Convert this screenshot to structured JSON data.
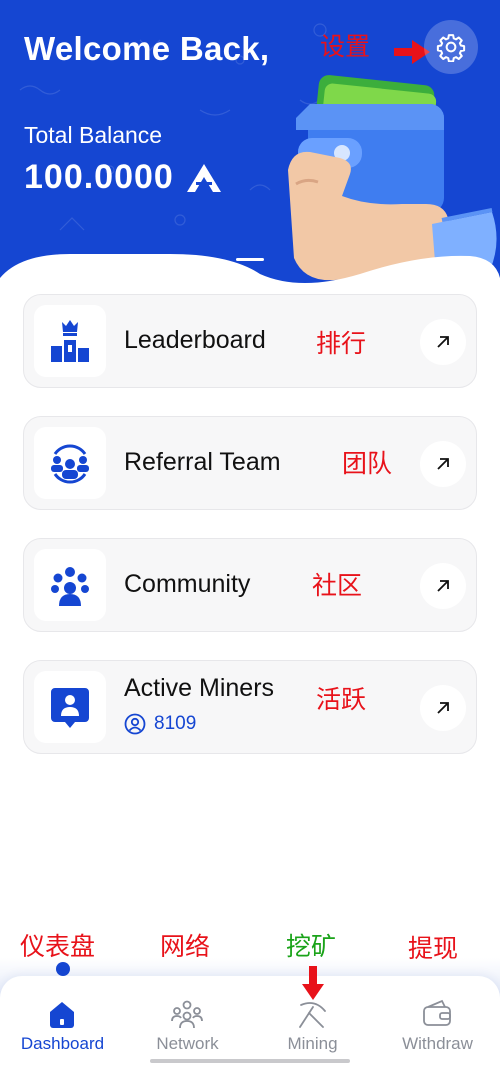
{
  "header": {
    "greeting": "Welcome Back,",
    "balance_label": "Total Balance",
    "balance_value": "100.0000",
    "coin_icon": "coin-logo-icon",
    "settings_icon": "gear-icon"
  },
  "cards": [
    {
      "title": "Leaderboard",
      "icon": "podium-crown-icon",
      "annotation": "排行"
    },
    {
      "title": "Referral Team",
      "icon": "team-circle-icon",
      "annotation": "团队"
    },
    {
      "title": "Community",
      "icon": "community-group-icon",
      "annotation": "社区"
    },
    {
      "title": "Active Miners",
      "icon": "miner-badge-icon",
      "annotation": "活跃",
      "count": "8109"
    }
  ],
  "annotations": {
    "settings": "设置",
    "dashboard": "仪表盘",
    "network": "网络",
    "mining": "挖矿",
    "withdraw": "提现"
  },
  "nav": [
    {
      "label": "Dashboard",
      "icon": "home-icon",
      "active": true
    },
    {
      "label": "Network",
      "icon": "network-icon",
      "active": false
    },
    {
      "label": "Mining",
      "icon": "pickaxe-icon",
      "active": false
    },
    {
      "label": "Withdraw",
      "icon": "wallet-icon",
      "active": false
    }
  ],
  "colors": {
    "primary": "#1546d2",
    "annotation_red": "#e8121a",
    "annotation_green": "#1aa319",
    "card_bg": "#f7f7f8",
    "nav_inactive": "#8b8f98"
  }
}
